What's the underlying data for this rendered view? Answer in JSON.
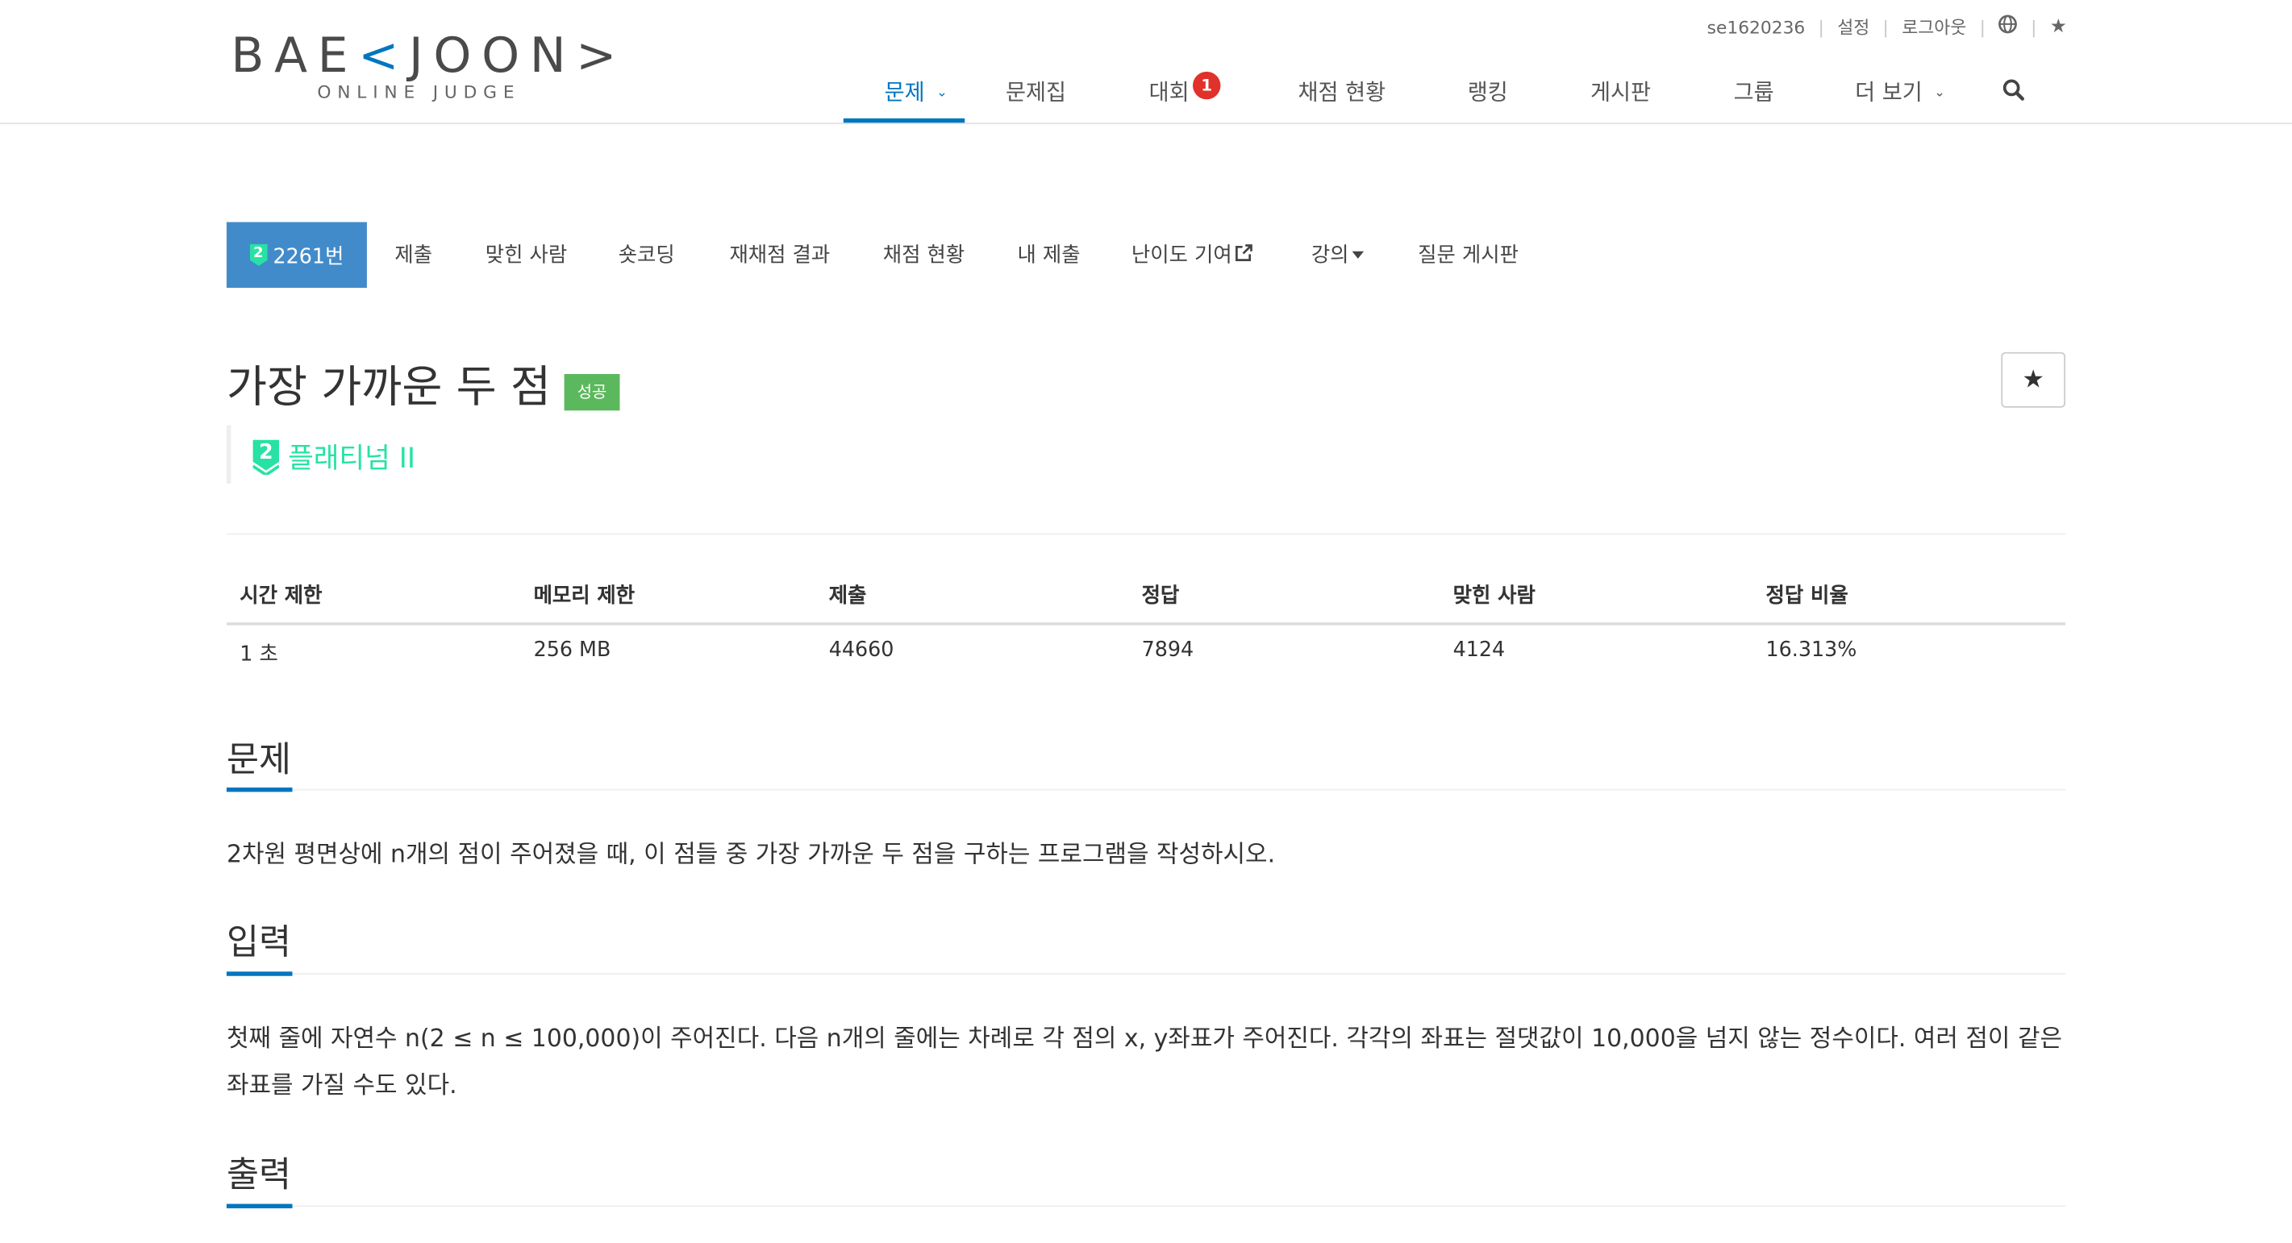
{
  "logo": {
    "main_pre": "BAE",
    "main_accent": "<",
    "main_post": "JOON>",
    "sub": "ONLINE JUDGE",
    "accent_color": "#0076c0"
  },
  "userbar": {
    "username": "se1620236",
    "settings": "설정",
    "logout": "로그아웃",
    "globe_icon": "globe-icon",
    "star_icon": "star-icon"
  },
  "nav": {
    "problems": "문제",
    "workbooks": "문제집",
    "contests": "대회",
    "contests_badge": "1",
    "status": "채점 현황",
    "ranking": "랭킹",
    "board": "게시판",
    "groups": "그룹",
    "more": "더 보기"
  },
  "problem_menu": {
    "number": "2261번",
    "tier_num": "2",
    "submit": "제출",
    "solvers": "맞힌 사람",
    "shortest": "숏코딩",
    "rejudge": "재채점 결과",
    "status": "채점 현황",
    "my_submissions": "내 제출",
    "difficulty": "난이도 기여",
    "lectures": "강의",
    "qna": "질문 게시판"
  },
  "problem": {
    "title": "가장 가까운 두 점",
    "result": "성공",
    "star_label": "★",
    "tier_num": "2",
    "tier": "플래티넘 II",
    "tier_color": "#27e2a4"
  },
  "info_table": {
    "headers": [
      "시간 제한",
      "메모리 제한",
      "제출",
      "정답",
      "맞힌 사람",
      "정답 비율"
    ],
    "values": [
      "1 초",
      "256 MB",
      "44660",
      "7894",
      "4124",
      "16.313%"
    ]
  },
  "sections": {
    "description_title": "문제",
    "description": "2차원 평면상에 n개의 점이 주어졌을 때, 이 점들 중 가장 가까운 두 점을 구하는 프로그램을 작성하시오.",
    "input_title": "입력",
    "input": "첫째 줄에 자연수 n(2 ≤ n ≤ 100,000)이 주어진다. 다음 n개의 줄에는 차례로 각 점의 x, y좌표가 주어진다. 각각의 좌표는 절댓값이 10,000을 넘지 않는 정수이다. 여러 점이 같은 좌표를 가질 수도 있다.",
    "output_title": "출력"
  }
}
